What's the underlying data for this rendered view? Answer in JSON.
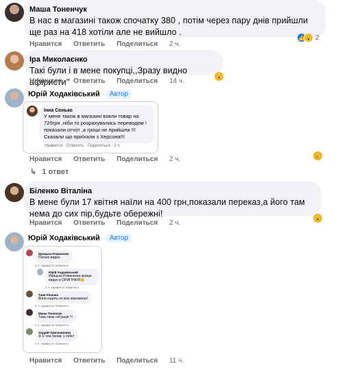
{
  "actions": {
    "like": "Нравится",
    "reply": "Ответить",
    "share": "Поделиться"
  },
  "comments": [
    {
      "author": "Маша Тоненчук",
      "text": "В нас в магазині також спочатку 380 , потім через пару днів прийшли ще раз на 418 хотіли але не вийшло .",
      "time": "2 ч.",
      "reaction_count": "2"
    },
    {
      "author": "Іра Миколаєнко",
      "text": "Такі були і в мене покупці,,Зразу видно афіристи''",
      "time": "14 ч."
    },
    {
      "author": "Юрій Ходаківський",
      "badge": "Автор",
      "time": "2 ч.",
      "screenshot": {
        "author": "Інна Сонько",
        "text": "У мене також в магазині взяли товар на 720грн ,ніби то розрахувались переводом !показали отчот ,а гроші не прийшли !!! Сказали що приїхали з Херсона!!!",
        "actions": "Нравится · Ответить · Поделиться · 2 ч."
      },
      "replies": "1 ответ"
    },
    {
      "author": "Біленко Віталіна",
      "text": "В мене були 17 квітня наїли на 400 грн,показали переказ,а його там нема до сих пір,будьте обережні!",
      "time": "2 ч."
    },
    {
      "author": "Юрій Ходаківський",
      "badge": "Автор",
      "time": "11 ч.",
      "screenshot": {
        "items": [
          {
            "author": "Ирицька Романенко",
            "text": "Погано видно",
            "actions": "3 ч. Нравится Ответить"
          },
          {
            "author": "Юрій Ходаківський",
            "text": "Ирицька Романенко краще видно в ОРИГІНАЛІ😊",
            "actions": "3 ч. Нравится Ответить"
          },
          {
            "author": "Таня Рієнник",
            "text": "Вони ходять по всіх магазинах!",
            "actions": "2 ч. Нравится Ответить"
          },
          {
            "author": "Маша Тоненчук",
            "text": "Така сама ситуація !!!",
            "actions": "2 ч. Нравится Ответить"
          },
          {
            "author": "Андрій Омельяненко",
            "text": "Я їх теж бачив, у себе!",
            "actions": "1 ч. Нравится Ответить"
          }
        ]
      }
    }
  ],
  "colors": {
    "link": "#1877f2",
    "bubble": "#f0f2f5",
    "muted": "#65676b"
  },
  "icons": [
    "like-icon",
    "haha-icon",
    "wow-icon",
    "sad-icon",
    "reply-arrow-icon"
  ]
}
